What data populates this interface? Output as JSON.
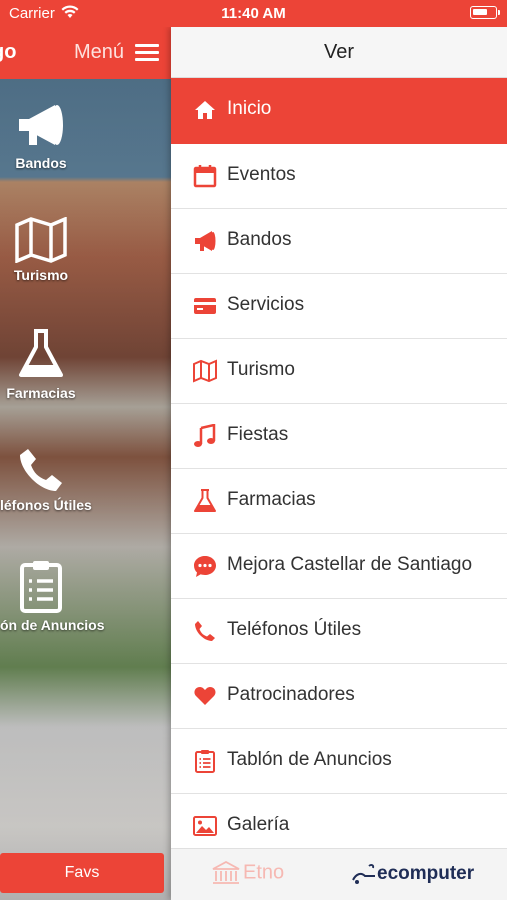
{
  "status_bar": {
    "carrier": "Carrier",
    "time": "11:40 AM"
  },
  "left_pane": {
    "title": "go",
    "menu_label": "Menú",
    "tiles": [
      {
        "label": "Bandos",
        "icon": "megaphone-icon"
      },
      {
        "label": "Turismo",
        "icon": "map-icon"
      },
      {
        "label": "Farmacias",
        "icon": "flask-icon"
      },
      {
        "label": "léfonos Útiles",
        "icon": "phone-icon"
      },
      {
        "label": "ón de Anuncios",
        "icon": "clipboard-icon"
      }
    ],
    "favs_label": "Favs"
  },
  "drawer": {
    "header_title": "Ver",
    "items": [
      {
        "label": "Inicio",
        "icon": "home-icon",
        "active": true
      },
      {
        "label": "Eventos",
        "icon": "calendar-icon"
      },
      {
        "label": "Bandos",
        "icon": "megaphone-icon"
      },
      {
        "label": "Servicios",
        "icon": "credit-card-icon"
      },
      {
        "label": "Turismo",
        "icon": "map-icon"
      },
      {
        "label": "Fiestas",
        "icon": "music-note-icon"
      },
      {
        "label": "Farmacias",
        "icon": "flask-icon"
      },
      {
        "label": "Mejora Castellar de Santiago",
        "icon": "chat-bubble-icon"
      },
      {
        "label": "Teléfonos Útiles",
        "icon": "phone-icon"
      },
      {
        "label": "Patrocinadores",
        "icon": "heart-icon"
      },
      {
        "label": "Tablón de Anuncios",
        "icon": "clipboard-icon"
      },
      {
        "label": "Galería",
        "icon": "image-icon"
      }
    ],
    "footer": {
      "brand_left": "Etno",
      "brand_right": "ecomputer"
    }
  },
  "colors": {
    "accent": "#ec4437",
    "text": "#333333",
    "header_bg": "#f6f6f6"
  }
}
